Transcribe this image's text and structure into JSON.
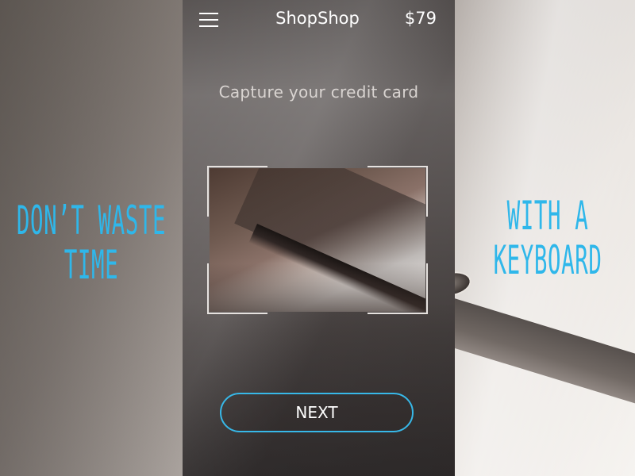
{
  "app": {
    "title": "ShopShop",
    "price": "$79"
  },
  "header": {
    "menu_icon": "hamburger-menu-icon"
  },
  "main": {
    "instruction": "Capture your credit card",
    "next_label": "NEXT"
  },
  "captions": {
    "left_line1": "DON’T WASTE",
    "left_line2": "TIME",
    "right_line1": "WITH A",
    "right_line2": "KEYBOARD"
  },
  "colors": {
    "accent": "#37b8e8",
    "caption": "#2fb7ea",
    "text": "#ffffff"
  }
}
